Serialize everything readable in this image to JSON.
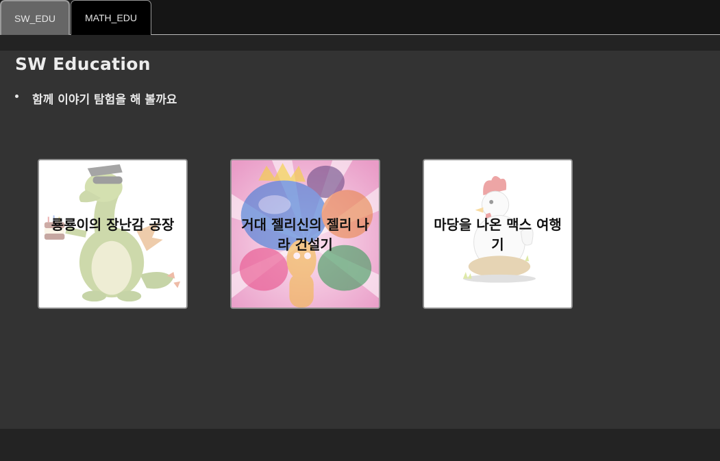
{
  "tabs": [
    {
      "label": "SW_EDU",
      "active": true
    },
    {
      "label": "MATH_EDU",
      "active": false
    }
  ],
  "main": {
    "title": "SW Education",
    "bullets": [
      "함께 이야기 탐험을 해 볼까요"
    ],
    "cards": [
      {
        "title": "룡룡이의 장난감 공장",
        "icon": "dragon-illustration"
      },
      {
        "title": "거대 젤리신의 젤리 나라 건설기",
        "icon": "jelly-characters-illustration"
      },
      {
        "title": "마당을 나온 맥스 여행기",
        "icon": "rooster-illustration"
      }
    ]
  },
  "colors": {
    "page_bg": "#232323",
    "tabbar_bg": "#151515",
    "active_tab_bg": "#666666",
    "inactive_tab_bg": "#000000",
    "panel_bg": "#333333",
    "card_bg": "#ffffff"
  }
}
